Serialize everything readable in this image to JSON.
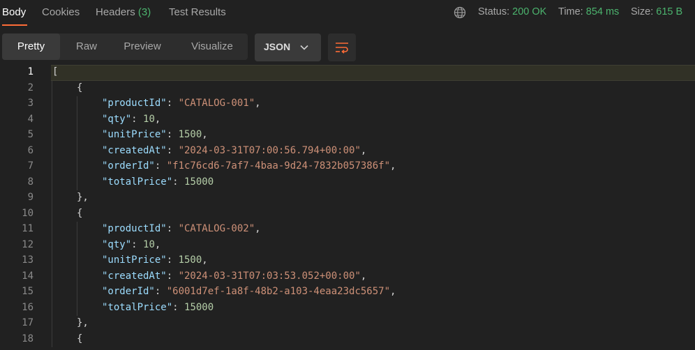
{
  "tabs": [
    {
      "label": "Body",
      "active": true
    },
    {
      "label": "Cookies"
    },
    {
      "label": "Headers",
      "count": "(3)"
    },
    {
      "label": "Test Results"
    }
  ],
  "status": {
    "status_label": "Status:",
    "status_value": "200 OK",
    "time_label": "Time:",
    "time_value": "854 ms",
    "size_label": "Size:",
    "size_value": "615 B"
  },
  "view_modes": [
    "Pretty",
    "Raw",
    "Preview",
    "Visualize"
  ],
  "format_select": "JSON",
  "icons": {
    "globe": "globe-icon",
    "chevron": "chevron-down-icon",
    "wrap": "word-wrap-icon"
  },
  "colors": {
    "accent": "#ff6c37",
    "success": "#4cb46e",
    "key": "#9cdcfe",
    "string": "#ce9178",
    "number": "#b5cea8"
  },
  "editor": {
    "current_line": 1,
    "line_numbers": [
      "1",
      "2",
      "3",
      "4",
      "5",
      "6",
      "7",
      "8",
      "9",
      "10",
      "11",
      "12",
      "13",
      "14",
      "15",
      "16",
      "17",
      "18"
    ],
    "records": [
      {
        "productId": "CATALOG-001",
        "qty": "10",
        "unitPrice": "1500",
        "createdAt": "2024-03-31T07:00:56.794+00:00",
        "orderId": "f1c76cd6-7af7-4baa-9d24-7832b057386f",
        "totalPrice": "15000"
      },
      {
        "productId": "CATALOG-002",
        "qty": "10",
        "unitPrice": "1500",
        "createdAt": "2024-03-31T07:03:53.052+00:00",
        "orderId": "6001d7ef-1a8f-48b2-a103-4eaa23dc5657",
        "totalPrice": "15000"
      }
    ]
  }
}
